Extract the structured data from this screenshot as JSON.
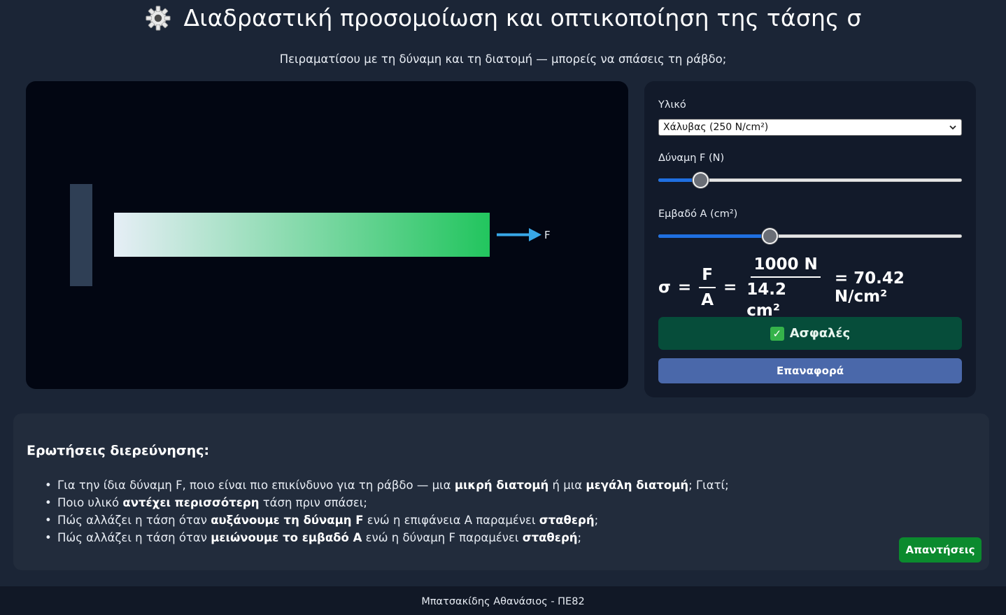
{
  "header": {
    "title": "Διαδραστική προσομοίωση και οπτικοποίηση της τάσης σ",
    "subtitle": "Πειραματίσου με τη δύναμη και τη διατομή — μπορείς να σπάσεις τη ράβδο;"
  },
  "simulation": {
    "force_label": "F",
    "colors": {
      "wall": "#2f3f55",
      "rod_start": "#e6eef6",
      "rod_end": "#22c55e",
      "arrow": "#38a8e8"
    }
  },
  "controls": {
    "material_label": "Υλικό",
    "material_selected": "Χάλυβας (250 N/cm²)",
    "force_label": "Δύναμη F (N)",
    "force_slider_fraction": 0.12,
    "area_label": "Εμβαδό A (cm²)",
    "area_slider_fraction": 0.36,
    "formula": {
      "sigma": "σ",
      "eq": "=",
      "f": "F",
      "a": "A",
      "force_value": "1000 N",
      "area_value": "14.2 cm²",
      "result": "= 70.42 N/cm²"
    },
    "status_icon": "✓",
    "status_text": "Ασφαλές",
    "reset_label": "Επαναφορά"
  },
  "questions": {
    "title": "Ερωτήσεις διερεύνησης:",
    "q1": {
      "a": "Για την ίδια δύναμη F, ποιο είναι πιο επικίνδυνο για τη ράβδο — μια ",
      "b1": "μικρή διατομή",
      "c": " ή μια ",
      "b2": "μεγάλη διατομή",
      "d": "; Γιατί;"
    },
    "q2": {
      "a": "Ποιο υλικό ",
      "b1": "αντέχει περισσότερη",
      "c": " τάση πριν σπάσει;"
    },
    "q3": {
      "a": "Πώς αλλάζει η τάση όταν ",
      "b1": "αυξάνουμε τη δύναμη F",
      "c": " ενώ η επιφάνεια A παραμένει ",
      "b2": "σταθερή",
      "d": ";"
    },
    "q4": {
      "a": "Πώς αλλάζει η τάση όταν ",
      "b1": "μειώνουμε το εμβαδό A",
      "c": " ενώ η δύναμη F παραμένει ",
      "b2": "σταθερή",
      "d": ";"
    },
    "answers_label": "Απαντήσεις"
  },
  "footer": {
    "text": "Μπατσακίδης Αθανάσιος - ΠΕ82"
  }
}
